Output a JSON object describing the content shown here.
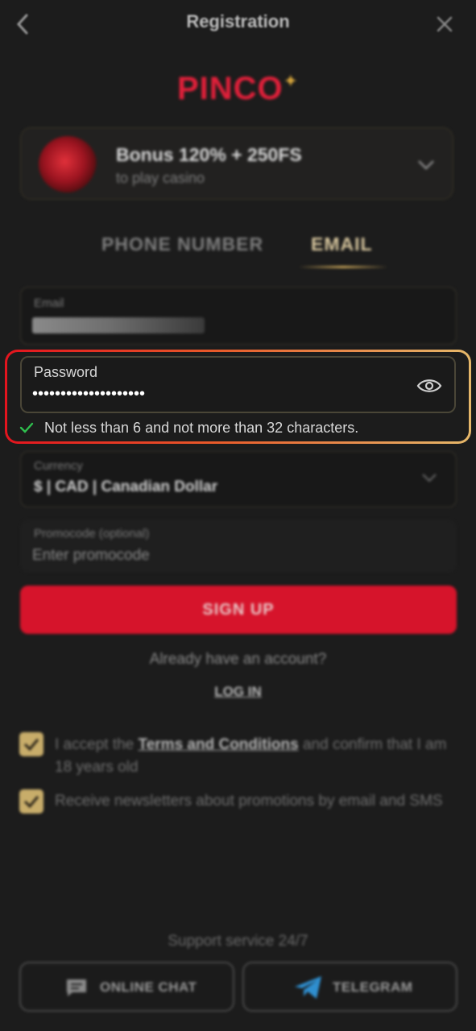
{
  "header": {
    "title": "Registration"
  },
  "logo": {
    "text": "PINCO"
  },
  "bonus": {
    "title": "Bonus 120% + 250FS",
    "subtitle": "to play casino"
  },
  "tabs": [
    {
      "label": "PHONE NUMBER",
      "active": false
    },
    {
      "label": "EMAIL",
      "active": true
    }
  ],
  "form": {
    "email": {
      "label": "Email"
    },
    "password": {
      "label": "Password",
      "value": "••••••••••••••••••••",
      "hint": "Not less than 6 and not more than 32 characters."
    },
    "currency": {
      "label": "Currency",
      "value": "$ | CAD | Canadian Dollar"
    },
    "promocode": {
      "label": "Promocode (optional)",
      "placeholder": "Enter promocode"
    }
  },
  "signup_label": "SIGN UP",
  "already_text": "Already have an account?",
  "login_label": "LOG IN",
  "consents": [
    {
      "checked": true,
      "pre": "I accept the ",
      "link": "Terms and Conditions",
      "post": " and confirm that I am 18 years old"
    },
    {
      "checked": true,
      "text": "Receive newsletters about promotions by email and SMS"
    }
  ],
  "support": {
    "title": "Support service 24/7",
    "buttons": [
      {
        "label": "ONLINE CHAT",
        "icon": "chat-icon"
      },
      {
        "label": "TELEGRAM",
        "icon": "telegram-icon"
      }
    ]
  },
  "colors": {
    "background": "#1c1c1c",
    "brand_red": "#d6142b",
    "gold": "#c8ad6a",
    "highlight_gradient": [
      "#e3141e",
      "#e6b86a"
    ],
    "check_green": "#2fbf4e"
  }
}
